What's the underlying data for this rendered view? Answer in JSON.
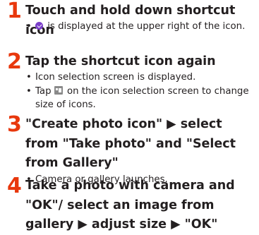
{
  "steps": [
    {
      "number": "1",
      "title": "Touch and hold down shortcut icon",
      "bullets": [
        {
          "icon": "purple-check-icon",
          "text": "is displayed at the upper right of the icon."
        }
      ]
    },
    {
      "number": "2",
      "title": "Tap the shortcut icon again",
      "bullets": [
        {
          "text": "Icon selection screen is displayed."
        },
        {
          "pre": "Tap",
          "icon": "icon-size-icon",
          "text": "on the icon selection screen to change size of icons."
        }
      ]
    },
    {
      "number": "3",
      "title": "\"Create photo icon\" ▶ select from \"Take photo\" and \"Select from Gallery\"",
      "bullets": [
        {
          "text": "Camera or gallery launches."
        }
      ]
    },
    {
      "number": "4",
      "title": "Take a photo with camera and \"OK\"/ select an image from gallery ▶ adjust size ▶ \"OK\""
    }
  ],
  "bullet_char": "•",
  "colors": {
    "step_number": "#e8380d",
    "text": "#231f20",
    "check_icon": "#7a3ec9",
    "size_icon": "#8a8a8a"
  }
}
